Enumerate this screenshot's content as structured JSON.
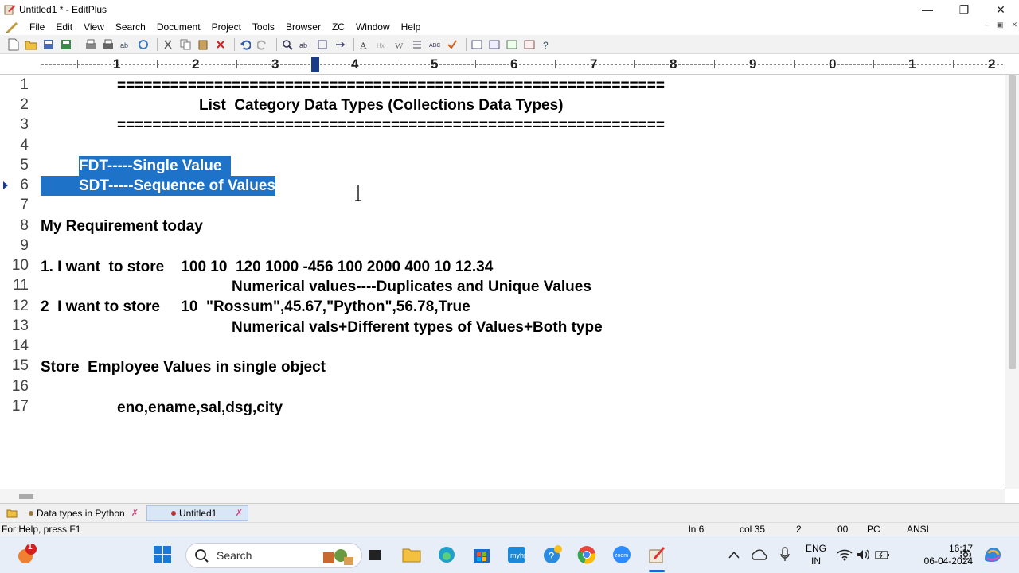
{
  "window": {
    "title": "Untitled1 * - EditPlus"
  },
  "menu": [
    "File",
    "Edit",
    "View",
    "Search",
    "Document",
    "Project",
    "Tools",
    "Browser",
    "ZC",
    "Window",
    "Help"
  ],
  "ruler": [
    "1",
    "2",
    "3",
    "4",
    "5",
    "6",
    "7",
    "8",
    "9",
    "0",
    "1",
    "2"
  ],
  "line_numbers": [
    "1",
    "2",
    "3",
    "4",
    "5",
    "6",
    "7",
    "8",
    "9",
    "10",
    "11",
    "12",
    "13",
    "14",
    "15",
    "16",
    "17"
  ],
  "editor": {
    "line1": "==============================================================",
    "line2": "List  Category Data Types (Collections Data Types)",
    "line3": "==============================================================",
    "line5": "FDT-----Single Value ",
    "line6": "SDT-----Sequence of Values",
    "line8": "My Requirement today",
    "line10": "1. I want  to store    100 10  120 1000 -456 100 2000 400 10 12.34",
    "line11": "Numerical values----Duplicates and Unique Values",
    "line12": "2  I want to store     10  \"Rossum\",45.67,\"Python\",56.78,True",
    "line13": "Numerical vals+Different types of Values+Both type",
    "line15": "Store  Employee Values in single object",
    "line17": "eno,ename,sal,dsg,city"
  },
  "tabs": [
    {
      "label": "Data types in Python",
      "active": false
    },
    {
      "label": "Untitled1",
      "active": true
    }
  ],
  "status": {
    "help": "For Help, press F1",
    "line": "ln 6",
    "col": "col 35",
    "field3": "2",
    "field4": "00",
    "mode": "PC",
    "encoding": "ANSI"
  },
  "taskbar": {
    "search_label": "Search",
    "notification_count": "1",
    "lang_top": "ENG",
    "lang_bottom": "IN",
    "time": "16:17",
    "date": "06-04-2024"
  },
  "colors": {
    "selection": "#1e73c8",
    "accent": "#1a3a8a"
  }
}
